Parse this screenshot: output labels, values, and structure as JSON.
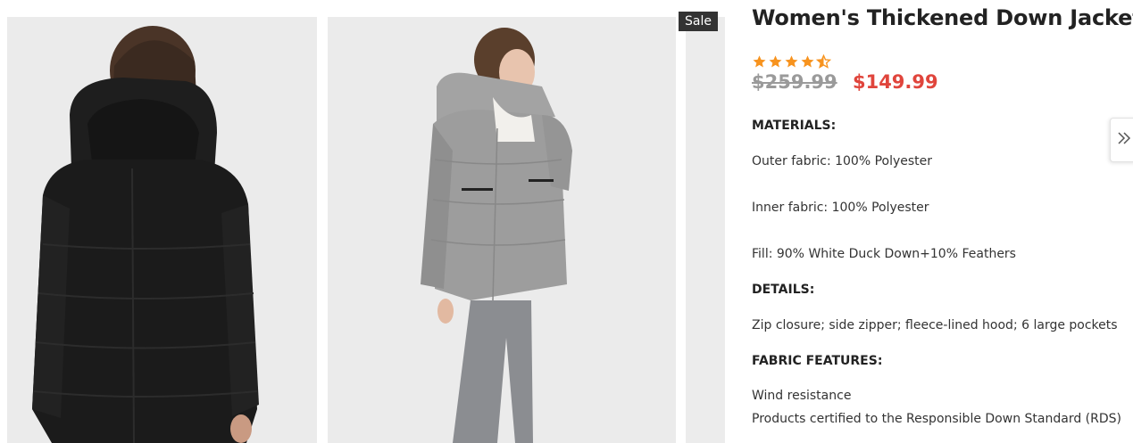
{
  "gallery": {
    "sale_badge": "Sale"
  },
  "product": {
    "title": "Women's Thickened Down Jacket",
    "rating": 4.5,
    "star_color": "#f7931e",
    "old_price": "$259.99",
    "new_price": "$149.99",
    "sale_color": "#e0453c"
  },
  "description": {
    "materials_heading": "MATERIALS:",
    "outer_fabric": "Outer fabric: 100% Polyester",
    "inner_fabric": "Inner fabric: 100% Polyester",
    "fill": "Fill: 90% White Duck Down+10% Feathers",
    "details_heading": "DETAILS:",
    "details_text": "Zip closure; side zipper; fleece-lined hood; 6 large pockets",
    "fabric_features_heading": "FABRIC FEATURES:",
    "feature_1": "Wind resistance",
    "feature_2": "Products certified to the Responsible Down Standard (RDS)"
  },
  "icons": {
    "next": "double-chevron-right-icon",
    "star": "star-icon",
    "half_star": "star-half-icon"
  }
}
